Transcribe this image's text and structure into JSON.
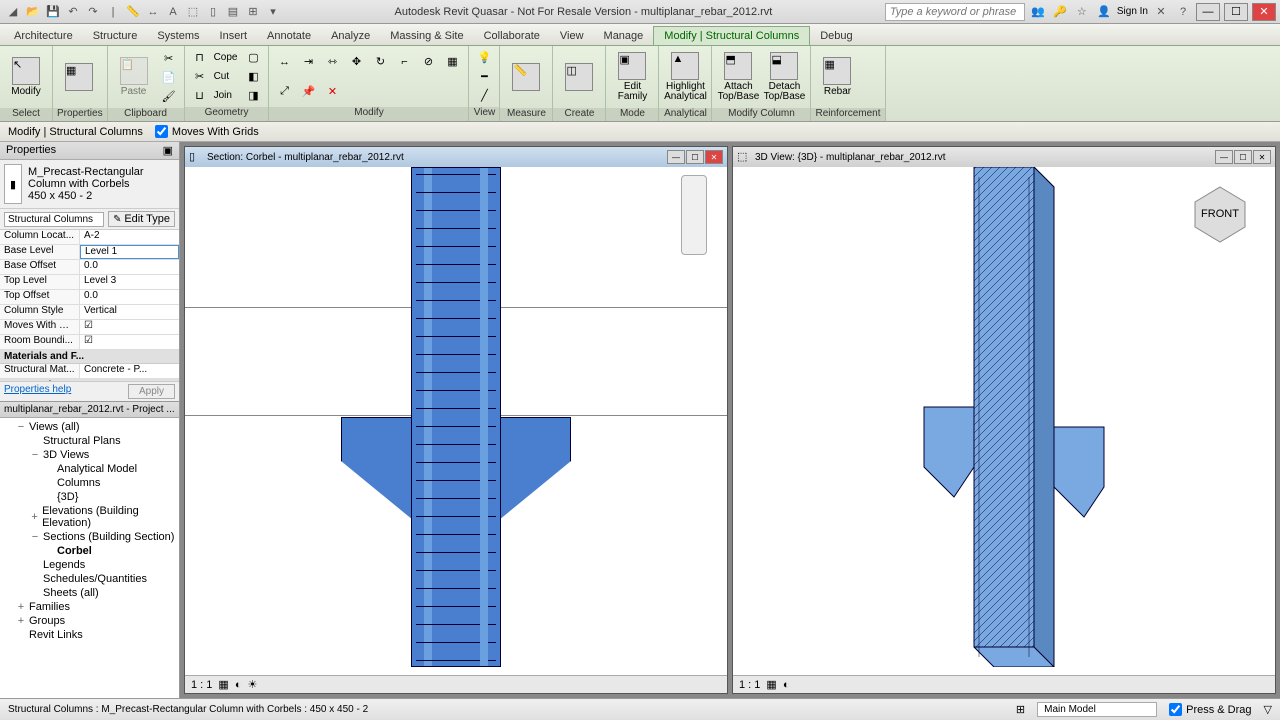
{
  "app": {
    "title": "Autodesk Revit Quasar - Not For Resale Version -     multiplanar_rebar_2012.rvt",
    "search_placeholder": "Type a keyword or phrase",
    "sign_in": "Sign In"
  },
  "ribbon_tabs": [
    "Architecture",
    "Structure",
    "Systems",
    "Insert",
    "Annotate",
    "Analyze",
    "Massing & Site",
    "Collaborate",
    "View",
    "Manage",
    "Modify | Structural Columns",
    "Debug"
  ],
  "active_tab": "Modify | Structural Columns",
  "panels": {
    "select": "Select",
    "properties": "Properties",
    "clipboard": "Clipboard",
    "geometry": "Geometry",
    "modify": "Modify",
    "view": "View",
    "measure": "Measure",
    "create": "Create",
    "mode": "Mode",
    "analytical": "Analytical",
    "modify_column": "Modify Column",
    "reinforcement": "Reinforcement"
  },
  "ribbon_btns": {
    "modify": "Modify",
    "paste": "Paste",
    "cope": "Cope",
    "cut": "Cut",
    "join": "Join",
    "edit_family": "Edit Family",
    "highlight_analytical": "Highlight Analytical",
    "attach": "Attach Top/Base",
    "detach": "Detach Top/Base",
    "rebar": "Rebar"
  },
  "options": {
    "context": "Modify | Structural Columns",
    "moves_with_grids": "Moves With Grids"
  },
  "properties": {
    "title": "Properties",
    "type_name": "M_Precast-Rectangular Column with Corbels",
    "type_size": "450 x 450 - 2",
    "category": "Structural Columns",
    "edit_type": "Edit Type",
    "rows": [
      {
        "k": "Column Locat...",
        "v": "A-2"
      },
      {
        "k": "Base Level",
        "v": "Level 1",
        "sel": true
      },
      {
        "k": "Base Offset",
        "v": "0.0"
      },
      {
        "k": "Top Level",
        "v": "Level 3"
      },
      {
        "k": "Top Offset",
        "v": "0.0"
      },
      {
        "k": "Column Style",
        "v": "Vertical"
      },
      {
        "k": "Moves With G...",
        "v": "☑"
      },
      {
        "k": "Room Boundi...",
        "v": "☑"
      }
    ],
    "group1": "Materials and F...",
    "mat_row": {
      "k": "Structural Mat...",
      "v": "Concrete - P..."
    },
    "group2": "Structural",
    "help": "Properties help",
    "apply": "Apply"
  },
  "browser": {
    "title": "multiplanar_rebar_2012.rvt - Project ...",
    "items": [
      {
        "lvl": 0,
        "exp": "−",
        "label": "Views (all)"
      },
      {
        "lvl": 1,
        "label": "Structural Plans"
      },
      {
        "lvl": 1,
        "exp": "−",
        "label": "3D Views"
      },
      {
        "lvl": 2,
        "label": "Analytical Model"
      },
      {
        "lvl": 2,
        "label": "Columns"
      },
      {
        "lvl": 2,
        "label": "{3D}"
      },
      {
        "lvl": 1,
        "exp": "+",
        "label": "Elevations (Building Elevation)"
      },
      {
        "lvl": 1,
        "exp": "−",
        "label": "Sections (Building Section)"
      },
      {
        "lvl": 2,
        "label": "Corbel",
        "bold": true
      },
      {
        "lvl": 1,
        "label": "Legends"
      },
      {
        "lvl": 1,
        "label": "Schedules/Quantities"
      },
      {
        "lvl": 1,
        "label": "Sheets (all)"
      },
      {
        "lvl": 0,
        "exp": "+",
        "label": "Families"
      },
      {
        "lvl": 0,
        "exp": "+",
        "label": "Groups"
      },
      {
        "lvl": 0,
        "label": "Revit Links"
      }
    ]
  },
  "views": {
    "section": {
      "title": "Section: Corbel - multiplanar_rebar_2012.rvt",
      "scale": "1 : 1"
    },
    "threed": {
      "title": "3D View: {3D} - multiplanar_rebar_2012.rvt",
      "scale": "1 : 1"
    }
  },
  "status": {
    "text": "Structural Columns : M_Precast-Rectangular Column with Corbels : 450 x 450 - 2",
    "model": "Main Model",
    "press_drag": "Press & Drag"
  }
}
